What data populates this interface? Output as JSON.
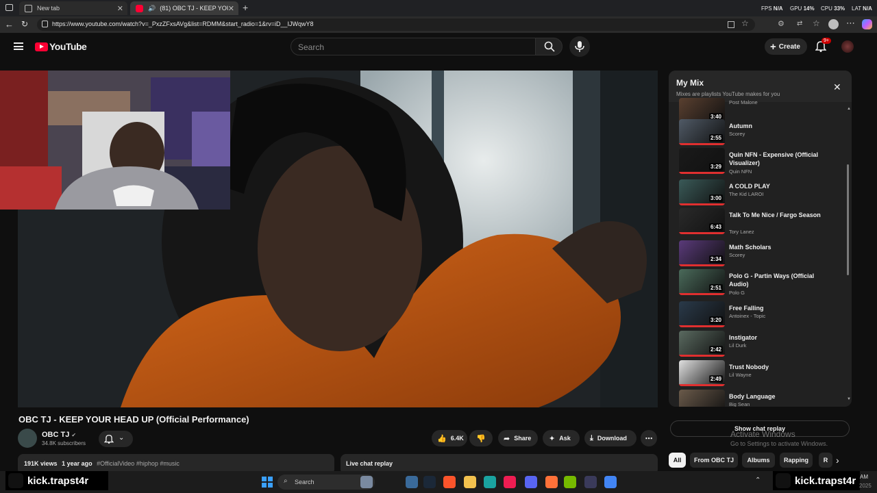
{
  "browser": {
    "tabs": [
      {
        "title": "New tab"
      },
      {
        "title": "(81) OBC TJ - KEEP YOUR HE"
      }
    ],
    "url": "https://www.youtube.com/watch?v=_PxzZFxsAVg&list=RDMM&start_radio=1&rv=iD__IJWqwY8",
    "stats": {
      "fps_label": "FPS",
      "fps_val": "N/A",
      "gpu_label": "GPU",
      "gpu_val": "14%",
      "cpu_label": "CPU",
      "cpu_val": "33%",
      "lat_label": "LAT",
      "lat_val": "N/A"
    }
  },
  "header": {
    "logo_text": "YouTube",
    "search_placeholder": "Search",
    "create_label": "Create",
    "notifications_badge": "9+"
  },
  "video": {
    "title": "OBC TJ - KEEP YOUR HEAD UP (Official Performance)",
    "channel": "OBC TJ",
    "subscribers": "34.8K subscribers",
    "likes": "6.4K",
    "share_label": "Share",
    "ask_label": "Ask",
    "download_label": "Download",
    "views": "191K views",
    "posted": "1 year ago",
    "hashtags": "#OfficialVideo #hiphop #music",
    "live_chat_label": "Live chat replay"
  },
  "mix": {
    "title": "My Mix",
    "subtitle": "Mixes are playlists YouTube makes for you",
    "items": [
      {
        "title": "",
        "artist": "Post Malone",
        "duration": "3:40",
        "color": "#5a4030"
      },
      {
        "title": "Autumn",
        "artist": "Scorey",
        "duration": "2:55",
        "color": "#505a66"
      },
      {
        "title": "Quin NFN - Expensive (Official Visualizer)",
        "artist": "Quin NFN",
        "duration": "3:29",
        "color": "#1a1a1a"
      },
      {
        "title": "A COLD PLAY",
        "artist": "The Kid LAROI",
        "duration": "3:00",
        "color": "#3a5a58"
      },
      {
        "title": "Talk To Me Nice / Fargo Season",
        "artist": "Tory Lanez",
        "duration": "6:43",
        "color": "#2a2a2a"
      },
      {
        "title": "Math Scholars",
        "artist": "Scorey",
        "duration": "2:34",
        "color": "#5a3a7a"
      },
      {
        "title": "Polo G - Partin Ways (Official Audio)",
        "artist": "Polo G",
        "duration": "2:51",
        "color": "#4a6a5a"
      },
      {
        "title": "Free Falling",
        "artist": "Antoinex - Topic",
        "duration": "3:20",
        "color": "#2a3a4a"
      },
      {
        "title": "Instigator",
        "artist": "Lil Durk",
        "duration": "2:42",
        "color": "#5a6a60"
      },
      {
        "title": "Trust Nobody",
        "artist": "Lil Wayne",
        "duration": "2:49",
        "color": "#e0e0e0"
      },
      {
        "title": "Body Language",
        "artist": "Big Sean",
        "duration": "",
        "color": "#6a5a4a"
      }
    ],
    "show_chat_label": "Show chat replay"
  },
  "chips": [
    "All",
    "From OBC TJ",
    "Albums",
    "Rapping",
    "R"
  ],
  "overlay": {
    "activate_title": "Activate Windows",
    "activate_sub": "Go to Settings to activate Windows."
  },
  "taskbar": {
    "search_label": "Search",
    "kick_left": "kick.trapst4r",
    "kick_right": "kick.trapst4r",
    "clock_am": "AM",
    "clock_date": "2025"
  }
}
